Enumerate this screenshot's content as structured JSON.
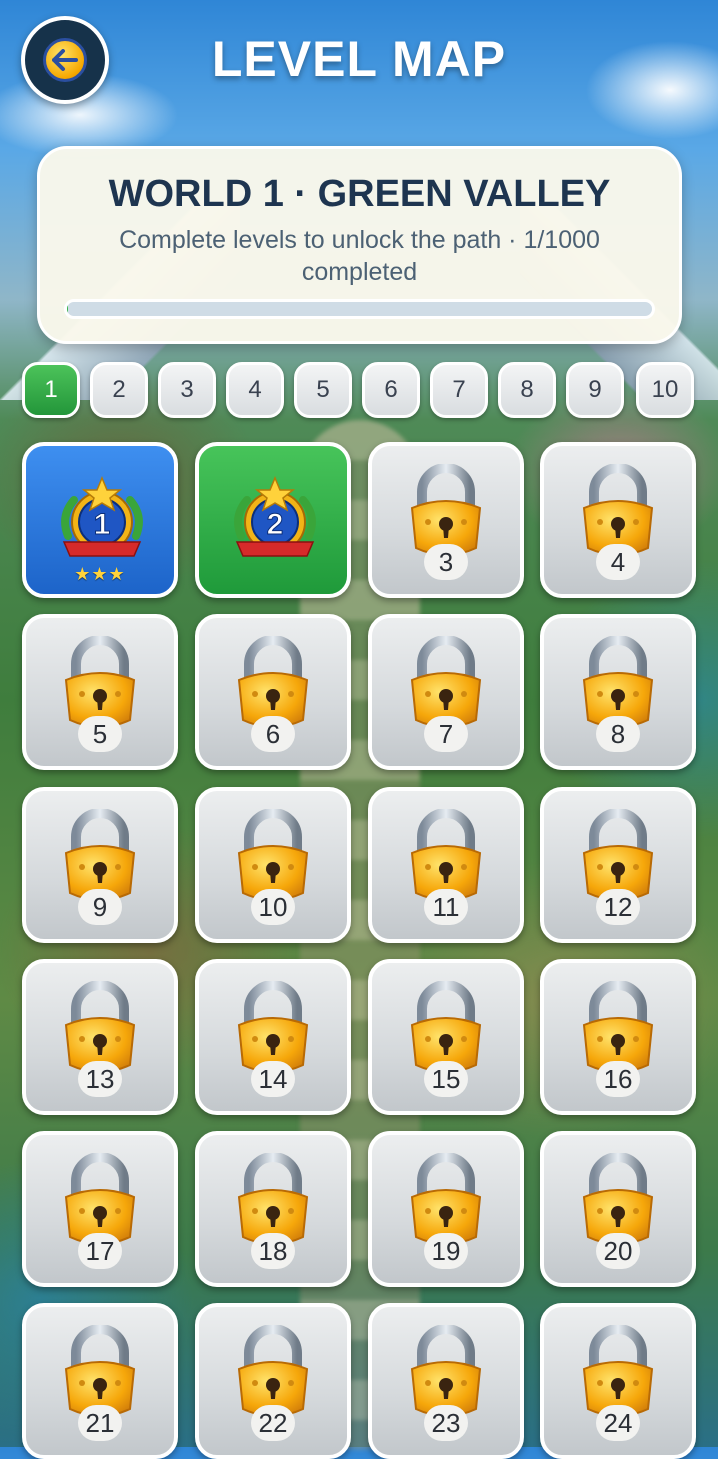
{
  "header": {
    "title": "LEVEL MAP",
    "back_icon": "back-arrow-icon"
  },
  "world": {
    "title": "WORLD 1 · GREEN VALLEY",
    "subtitle": "Complete levels to unlock the path · 1/1000 completed",
    "progress": 0.001
  },
  "pages": {
    "items": [
      "1",
      "2",
      "3",
      "4",
      "5",
      "6",
      "7",
      "8",
      "9",
      "10"
    ],
    "active": "1"
  },
  "levels": [
    {
      "number": "1",
      "state": "completed",
      "stars": "★★★",
      "color": "#2a78df"
    },
    {
      "number": "2",
      "state": "current",
      "color": "#2eab45"
    },
    {
      "number": "3",
      "state": "locked"
    },
    {
      "number": "4",
      "state": "locked"
    },
    {
      "number": "5",
      "state": "locked"
    },
    {
      "number": "6",
      "state": "locked"
    },
    {
      "number": "7",
      "state": "locked"
    },
    {
      "number": "8",
      "state": "locked"
    },
    {
      "number": "9",
      "state": "locked"
    },
    {
      "number": "10",
      "state": "locked"
    },
    {
      "number": "11",
      "state": "locked"
    },
    {
      "number": "12",
      "state": "locked"
    },
    {
      "number": "13",
      "state": "locked"
    },
    {
      "number": "14",
      "state": "locked"
    },
    {
      "number": "15",
      "state": "locked"
    },
    {
      "number": "16",
      "state": "locked"
    },
    {
      "number": "17",
      "state": "locked"
    },
    {
      "number": "18",
      "state": "locked"
    },
    {
      "number": "19",
      "state": "locked"
    },
    {
      "number": "20",
      "state": "locked"
    },
    {
      "number": "21",
      "state": "locked"
    },
    {
      "number": "22",
      "state": "locked"
    },
    {
      "number": "23",
      "state": "locked"
    },
    {
      "number": "24",
      "state": "locked"
    }
  ]
}
